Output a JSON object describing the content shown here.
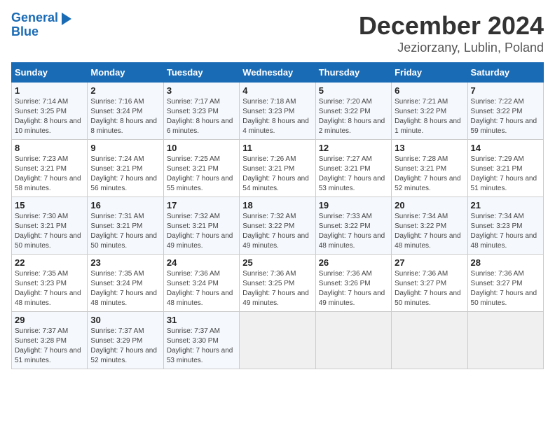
{
  "header": {
    "logo_line1": "General",
    "logo_line2": "Blue",
    "title": "December 2024",
    "subtitle": "Jeziorzany, Lublin, Poland"
  },
  "days_of_week": [
    "Sunday",
    "Monday",
    "Tuesday",
    "Wednesday",
    "Thursday",
    "Friday",
    "Saturday"
  ],
  "weeks": [
    [
      {
        "num": "1",
        "rise": "Sunrise: 7:14 AM",
        "set": "Sunset: 3:25 PM",
        "daylight": "Daylight: 8 hours and 10 minutes."
      },
      {
        "num": "2",
        "rise": "Sunrise: 7:16 AM",
        "set": "Sunset: 3:24 PM",
        "daylight": "Daylight: 8 hours and 8 minutes."
      },
      {
        "num": "3",
        "rise": "Sunrise: 7:17 AM",
        "set": "Sunset: 3:23 PM",
        "daylight": "Daylight: 8 hours and 6 minutes."
      },
      {
        "num": "4",
        "rise": "Sunrise: 7:18 AM",
        "set": "Sunset: 3:23 PM",
        "daylight": "Daylight: 8 hours and 4 minutes."
      },
      {
        "num": "5",
        "rise": "Sunrise: 7:20 AM",
        "set": "Sunset: 3:22 PM",
        "daylight": "Daylight: 8 hours and 2 minutes."
      },
      {
        "num": "6",
        "rise": "Sunrise: 7:21 AM",
        "set": "Sunset: 3:22 PM",
        "daylight": "Daylight: 8 hours and 1 minute."
      },
      {
        "num": "7",
        "rise": "Sunrise: 7:22 AM",
        "set": "Sunset: 3:22 PM",
        "daylight": "Daylight: 7 hours and 59 minutes."
      }
    ],
    [
      {
        "num": "8",
        "rise": "Sunrise: 7:23 AM",
        "set": "Sunset: 3:21 PM",
        "daylight": "Daylight: 7 hours and 58 minutes."
      },
      {
        "num": "9",
        "rise": "Sunrise: 7:24 AM",
        "set": "Sunset: 3:21 PM",
        "daylight": "Daylight: 7 hours and 56 minutes."
      },
      {
        "num": "10",
        "rise": "Sunrise: 7:25 AM",
        "set": "Sunset: 3:21 PM",
        "daylight": "Daylight: 7 hours and 55 minutes."
      },
      {
        "num": "11",
        "rise": "Sunrise: 7:26 AM",
        "set": "Sunset: 3:21 PM",
        "daylight": "Daylight: 7 hours and 54 minutes."
      },
      {
        "num": "12",
        "rise": "Sunrise: 7:27 AM",
        "set": "Sunset: 3:21 PM",
        "daylight": "Daylight: 7 hours and 53 minutes."
      },
      {
        "num": "13",
        "rise": "Sunrise: 7:28 AM",
        "set": "Sunset: 3:21 PM",
        "daylight": "Daylight: 7 hours and 52 minutes."
      },
      {
        "num": "14",
        "rise": "Sunrise: 7:29 AM",
        "set": "Sunset: 3:21 PM",
        "daylight": "Daylight: 7 hours and 51 minutes."
      }
    ],
    [
      {
        "num": "15",
        "rise": "Sunrise: 7:30 AM",
        "set": "Sunset: 3:21 PM",
        "daylight": "Daylight: 7 hours and 50 minutes."
      },
      {
        "num": "16",
        "rise": "Sunrise: 7:31 AM",
        "set": "Sunset: 3:21 PM",
        "daylight": "Daylight: 7 hours and 50 minutes."
      },
      {
        "num": "17",
        "rise": "Sunrise: 7:32 AM",
        "set": "Sunset: 3:21 PM",
        "daylight": "Daylight: 7 hours and 49 minutes."
      },
      {
        "num": "18",
        "rise": "Sunrise: 7:32 AM",
        "set": "Sunset: 3:22 PM",
        "daylight": "Daylight: 7 hours and 49 minutes."
      },
      {
        "num": "19",
        "rise": "Sunrise: 7:33 AM",
        "set": "Sunset: 3:22 PM",
        "daylight": "Daylight: 7 hours and 48 minutes."
      },
      {
        "num": "20",
        "rise": "Sunrise: 7:34 AM",
        "set": "Sunset: 3:22 PM",
        "daylight": "Daylight: 7 hours and 48 minutes."
      },
      {
        "num": "21",
        "rise": "Sunrise: 7:34 AM",
        "set": "Sunset: 3:23 PM",
        "daylight": "Daylight: 7 hours and 48 minutes."
      }
    ],
    [
      {
        "num": "22",
        "rise": "Sunrise: 7:35 AM",
        "set": "Sunset: 3:23 PM",
        "daylight": "Daylight: 7 hours and 48 minutes."
      },
      {
        "num": "23",
        "rise": "Sunrise: 7:35 AM",
        "set": "Sunset: 3:24 PM",
        "daylight": "Daylight: 7 hours and 48 minutes."
      },
      {
        "num": "24",
        "rise": "Sunrise: 7:36 AM",
        "set": "Sunset: 3:24 PM",
        "daylight": "Daylight: 7 hours and 48 minutes."
      },
      {
        "num": "25",
        "rise": "Sunrise: 7:36 AM",
        "set": "Sunset: 3:25 PM",
        "daylight": "Daylight: 7 hours and 49 minutes."
      },
      {
        "num": "26",
        "rise": "Sunrise: 7:36 AM",
        "set": "Sunset: 3:26 PM",
        "daylight": "Daylight: 7 hours and 49 minutes."
      },
      {
        "num": "27",
        "rise": "Sunrise: 7:36 AM",
        "set": "Sunset: 3:27 PM",
        "daylight": "Daylight: 7 hours and 50 minutes."
      },
      {
        "num": "28",
        "rise": "Sunrise: 7:36 AM",
        "set": "Sunset: 3:27 PM",
        "daylight": "Daylight: 7 hours and 50 minutes."
      }
    ],
    [
      {
        "num": "29",
        "rise": "Sunrise: 7:37 AM",
        "set": "Sunset: 3:28 PM",
        "daylight": "Daylight: 7 hours and 51 minutes."
      },
      {
        "num": "30",
        "rise": "Sunrise: 7:37 AM",
        "set": "Sunset: 3:29 PM",
        "daylight": "Daylight: 7 hours and 52 minutes."
      },
      {
        "num": "31",
        "rise": "Sunrise: 7:37 AM",
        "set": "Sunset: 3:30 PM",
        "daylight": "Daylight: 7 hours and 53 minutes."
      },
      null,
      null,
      null,
      null
    ]
  ]
}
